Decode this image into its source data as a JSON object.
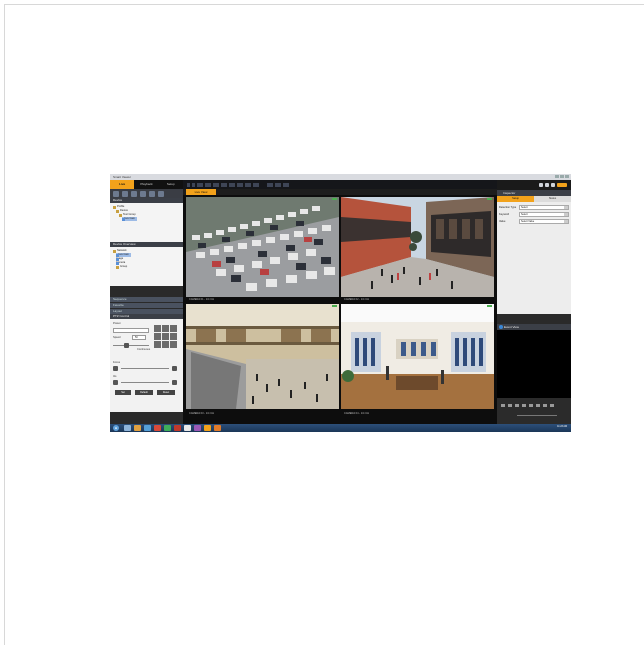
{
  "window": {
    "title": "Smart Viewer"
  },
  "left": {
    "tabs": [
      {
        "label": "Live"
      },
      {
        "label": "Playback"
      },
      {
        "label": "Setup"
      }
    ],
    "device_section": {
      "title": "Device"
    },
    "device_tree": [
      {
        "label": "Profile"
      },
      {
        "label": "Device"
      },
      {
        "label": "Test Group"
      },
      {
        "label": "Live Cam"
      }
    ],
    "favorite_section": {
      "title": "Device Overview"
    },
    "overview_tree": [
      {
        "label": "Network"
      },
      {
        "label": "Live Cam"
      },
      {
        "label": "Image"
      },
      {
        "label": "Camera"
      },
      {
        "label": "Group"
      }
    ],
    "collapsed_sections": [
      {
        "label": "Sequence"
      },
      {
        "label": "Favorite"
      },
      {
        "label": "Layout"
      }
    ],
    "ptz": {
      "title": "PTZ Control",
      "preset_label": "Preset",
      "speed_label": "Speed",
      "speed_value": "50",
      "continuous_label": "Continuous",
      "focus_label": "Focus",
      "iris_label": "Iris",
      "buttons": [
        {
          "label": "Set"
        },
        {
          "label": "Default"
        },
        {
          "label": "Reset"
        }
      ]
    }
  },
  "center": {
    "live_tab": "Live View",
    "cameras": [
      {
        "label": "CAMERA 01 - 1/4 CH"
      },
      {
        "label": "CAMERA 02 - 1/4 CH"
      },
      {
        "label": "CAMERA 03 - 1/4 CH"
      },
      {
        "label": "CAMERA 04 - 1/4 CH"
      }
    ]
  },
  "right": {
    "inspector_title": "Inspector",
    "tabs": [
      {
        "label": "Setup"
      },
      {
        "label": "Status"
      }
    ],
    "fields": [
      {
        "key": "Detection Type",
        "value": "Select"
      },
      {
        "key": "Keyword",
        "value": "Select"
      },
      {
        "key": "Value",
        "value": "Select Value"
      }
    ],
    "event_view_title": "Event View"
  },
  "taskbar": {
    "start_label": "⊞",
    "clock": "11:23 AM"
  },
  "colors": {
    "accent": "#f2a21b",
    "panel": "#2a2a2a",
    "taskbar": "#1f3b60"
  },
  "icons": [
    "start-icon",
    "folder-icon",
    "camera-icon",
    "settings-icon",
    "minimize-icon",
    "maximize-icon",
    "close-icon"
  ]
}
